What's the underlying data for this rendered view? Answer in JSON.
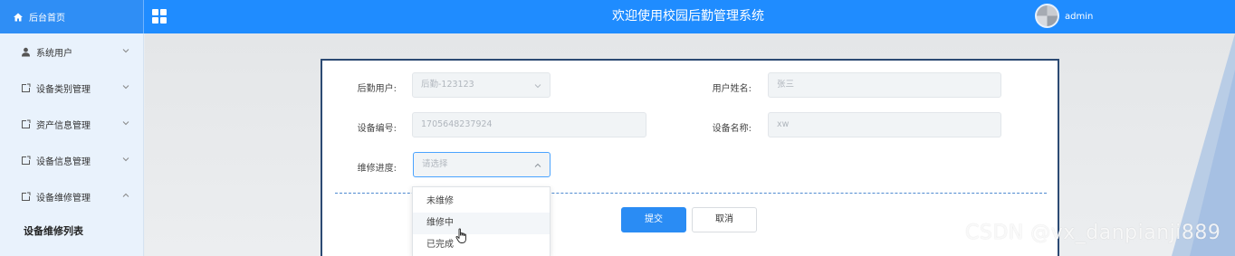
{
  "header": {
    "brand_label": "后台首页",
    "title": "欢迎使用校园后勤管理系统",
    "username": "admin",
    "accent_color": "#1f8cff"
  },
  "sidebar": {
    "items": [
      {
        "label": "系统用户",
        "icon": "user-icon"
      },
      {
        "label": "设备类别管理",
        "icon": "external-link-icon"
      },
      {
        "label": "资产信息管理",
        "icon": "external-link-icon"
      },
      {
        "label": "设备信息管理",
        "icon": "external-link-icon"
      },
      {
        "label": "设备维修管理",
        "icon": "external-link-icon",
        "expanded": true
      }
    ],
    "sub_item": "设备维修列表"
  },
  "form": {
    "logistics_user_label": "后勤用户:",
    "logistics_user_value": "后勤-123123",
    "user_name_label": "用户姓名:",
    "user_name_value": "张三",
    "device_no_label": "设备编号:",
    "device_no_value": "1705648237924",
    "device_name_label": "设备名称:",
    "device_name_value": "xw",
    "progress_label": "维修进度:",
    "progress_placeholder": "请选择",
    "submit_label": "提交",
    "cancel_label": "取消"
  },
  "dropdown": {
    "options": [
      "未维修",
      "维修中",
      "已完成"
    ],
    "hovered_index": 1
  },
  "watermark": "CSDN @vx_danpianji889"
}
